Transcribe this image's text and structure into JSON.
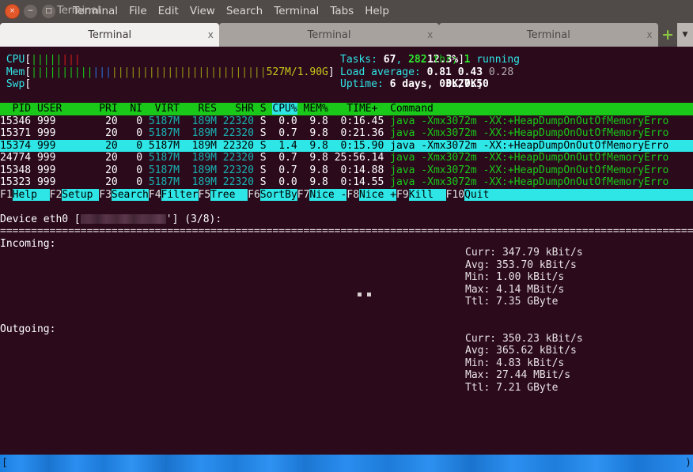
{
  "window": {
    "title": "Terminal",
    "menu": [
      "Terminal",
      "File",
      "Edit",
      "View",
      "Search",
      "Terminal",
      "Tabs",
      "Help"
    ],
    "controls": {
      "close": "×",
      "minimize": "−",
      "maximize": "□"
    }
  },
  "tabs": {
    "items": [
      {
        "label": "Terminal",
        "close": "x",
        "active": true
      },
      {
        "label": "Terminal",
        "close": "x",
        "active": false
      },
      {
        "label": "Terminal",
        "close": "x",
        "active": false
      }
    ],
    "new_tab": "+",
    "tab_menu": "▼"
  },
  "htop": {
    "cpu": {
      "label": "CPU",
      "bracket_open": "[",
      "bars_green": "|||||",
      "bars_red": "|||",
      "value": "12.3%",
      "bracket_close": "]"
    },
    "mem": {
      "label": "Mem",
      "bracket_open": "[",
      "bars_green": "||||||||||",
      "bars_blue": "|||",
      "bars_olive": "|||||||||||||||||||||||||",
      "value": "527M/1.90G",
      "bracket_close": "]"
    },
    "swp": {
      "label": "Swp",
      "bracket_open": "[",
      "value": "0K/0K",
      "bracket_close": "]"
    },
    "tasks": {
      "label": "Tasks:",
      "count": "67",
      "comma": ",",
      "thr_count": "282",
      "thr_label": "thr;",
      "running_count": "1",
      "running_label": "running"
    },
    "load": {
      "label": "Load average:",
      "one": "0.81",
      "five": "0.43",
      "fifteen": "0.28"
    },
    "uptime": {
      "label": "Uptime:",
      "value": "6 days, 03:27:50"
    },
    "table": {
      "headers_pre": "  PID USER      PRI  NI  VIRT   RES   SHR S ",
      "header_sort": "CPU%",
      "headers_post": " MEM%   TIME+  Command                                                                             ",
      "columns": [
        "PID",
        "USER",
        "PRI",
        "NI",
        "VIRT",
        "RES",
        "SHR",
        "S",
        "CPU%",
        "MEM%",
        "TIME+",
        "Command"
      ],
      "rows": [
        {
          "pid": "15346",
          "user": "999",
          "pri": "20",
          "ni": "0",
          "virt": "5187M",
          "res": "189M",
          "shr": "22320",
          "s": "S",
          "cpu": "0.0",
          "mem": "9.8",
          "time": "0:16.45",
          "command": "java -Xmx3072m -XX:+HeapDumpOnOutOfMemoryErro",
          "selected": false
        },
        {
          "pid": "15371",
          "user": "999",
          "pri": "20",
          "ni": "0",
          "virt": "5187M",
          "res": "189M",
          "shr": "22320",
          "s": "S",
          "cpu": "0.7",
          "mem": "9.8",
          "time": "0:21.36",
          "command": "java -Xmx3072m -XX:+HeapDumpOnOutOfMemoryErro",
          "selected": false
        },
        {
          "pid": "15374",
          "user": "999",
          "pri": "20",
          "ni": "0",
          "virt": "5187M",
          "res": "189M",
          "shr": "22320",
          "s": "S",
          "cpu": "1.4",
          "mem": "9.8",
          "time": "0:15.90",
          "command": "java -Xmx3072m -XX:+HeapDumpOnOutOfMemoryErro",
          "selected": true
        },
        {
          "pid": "24774",
          "user": "999",
          "pri": "20",
          "ni": "0",
          "virt": "5187M",
          "res": "189M",
          "shr": "22320",
          "s": "S",
          "cpu": "0.7",
          "mem": "9.8",
          "time": "25:56.14",
          "command": "java -Xmx3072m -XX:+HeapDumpOnOutOfMemoryErro",
          "selected": false
        },
        {
          "pid": "15348",
          "user": "999",
          "pri": "20",
          "ni": "0",
          "virt": "5187M",
          "res": "189M",
          "shr": "22320",
          "s": "S",
          "cpu": "0.7",
          "mem": "9.8",
          "time": "0:14.88",
          "command": "java -Xmx3072m -XX:+HeapDumpOnOutOfMemoryErro",
          "selected": false
        },
        {
          "pid": "15323",
          "user": "999",
          "pri": "20",
          "ni": "0",
          "virt": "5187M",
          "res": "189M",
          "shr": "22320",
          "s": "S",
          "cpu": "0.0",
          "mem": "9.8",
          "time": "0:14.55",
          "command": "java -Xmx3072m -XX:+HeapDumpOnOutOfMemoryErro",
          "selected": false
        }
      ]
    },
    "fkeys": [
      {
        "key": "F1",
        "label": "Help  "
      },
      {
        "key": "F2",
        "label": "Setup "
      },
      {
        "key": "F3",
        "label": "Search"
      },
      {
        "key": "F4",
        "label": "Filter"
      },
      {
        "key": "F5",
        "label": "Tree  "
      },
      {
        "key": "F6",
        "label": "SortBy"
      },
      {
        "key": "F7",
        "label": "Nice -"
      },
      {
        "key": "F8",
        "label": "Nice +"
      },
      {
        "key": "F9",
        "label": "Kill  "
      },
      {
        "key": "F10",
        "label": "Quit  "
      }
    ]
  },
  "nload": {
    "device_prefix": "Device eth0 [",
    "device_suffix": "'] (3/8):",
    "divider": "================================================================================================================",
    "incoming_label": "Incoming:",
    "outgoing_label": "Outgoing:",
    "incoming": {
      "curr_label": "Curr:",
      "curr_value": "347.79 kBit/s",
      "avg_label": "Avg:",
      "avg_value": "353.70 kBit/s",
      "min_label": "Min:",
      "min_value": "1.00 kBit/s",
      "max_label": "Max:",
      "max_value": "4.14 MBit/s",
      "ttl_label": "Ttl:",
      "ttl_value": "7.35 GByte"
    },
    "outgoing": {
      "curr_label": "Curr:",
      "curr_value": "350.23 kBit/s",
      "avg_label": "Avg:",
      "avg_value": "365.62 kBit/s",
      "min_label": "Min:",
      "min_value": "4.83 kBit/s",
      "max_label": "Max:",
      "max_value": "27.44 MBit/s",
      "ttl_label": "Ttl:",
      "ttl_value": "7.21 GByte"
    },
    "graph_dots": "..",
    "bottom_dots": "...............................................................",
    "bottom_bracket_left": "[",
    "bottom_bracket_right": ")"
  },
  "colors": {
    "terminal_bg": "#2b0a1c",
    "cyan": "#2ee6e6",
    "green": "#19c819",
    "red": "#d01b1b",
    "blue": "#2a6fd6",
    "olive": "#9a9a14",
    "titlebar": "#504a48",
    "tab_active": "#f2f0ef",
    "tab_inactive": "#a8a29f",
    "accent_green": "#8ac63f",
    "bottom_bar": "#2b8ef0"
  }
}
